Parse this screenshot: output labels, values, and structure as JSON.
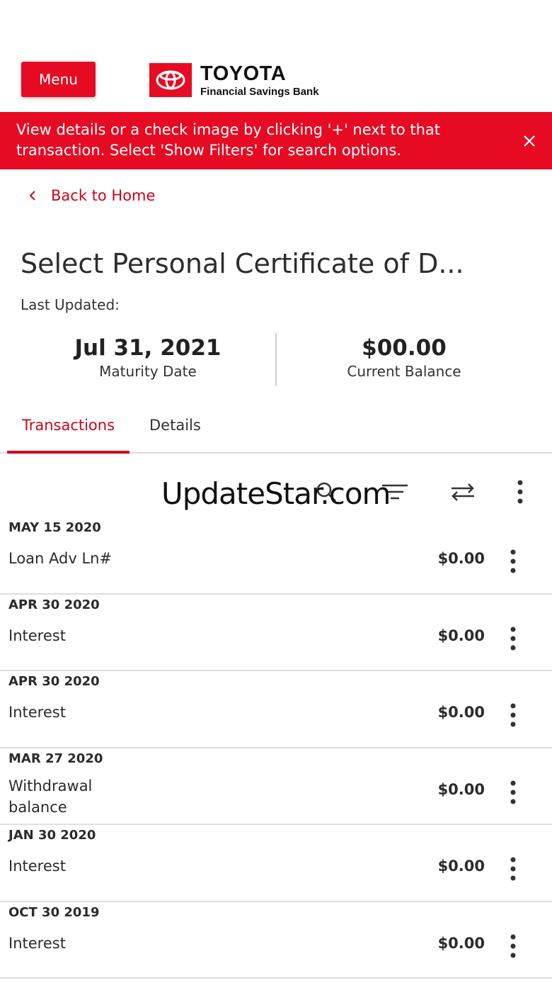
{
  "header": {
    "menu_label": "Menu",
    "brand": "TOYOTA",
    "brand_sub": "Financial Savings Bank",
    "brand_color": "#e60b23"
  },
  "banner": {
    "message": "View details or a check image by clicking '+' next to that transaction. Select 'Show Filters' for search options.",
    "close_icon": "close-icon"
  },
  "nav": {
    "back_label": "Back to Home"
  },
  "account": {
    "title": "Select Personal Certificate of D...",
    "last_updated_label": "Last Updated:",
    "maturity_date": "Jul 31, 2021",
    "maturity_label": "Maturity Date",
    "balance": "$00.00",
    "balance_label": "Current Balance"
  },
  "tabs": [
    {
      "label": "Transactions",
      "active": true
    },
    {
      "label": "Details",
      "active": false
    }
  ],
  "toolbar": {
    "icons": [
      "search-icon",
      "filter-icon",
      "transfer-icon",
      "more-vertical-icon"
    ]
  },
  "watermark": "UpdateStar.com",
  "transactions": [
    {
      "date": "MAY 15 2020",
      "description": "Loan Adv Ln#",
      "amount": "$0.00"
    },
    {
      "date": "APR 30 2020",
      "description": "Interest",
      "amount": "$0.00"
    },
    {
      "date": "APR 30 2020",
      "description": "Interest",
      "amount": "$0.00"
    },
    {
      "date": "MAR 27 2020",
      "description": "Withdrawal balance",
      "amount": "$0.00"
    },
    {
      "date": "JAN 30 2020",
      "description": "Interest",
      "amount": "$0.00"
    },
    {
      "date": "OCT 30 2019",
      "description": "Interest",
      "amount": "$0.00"
    }
  ]
}
